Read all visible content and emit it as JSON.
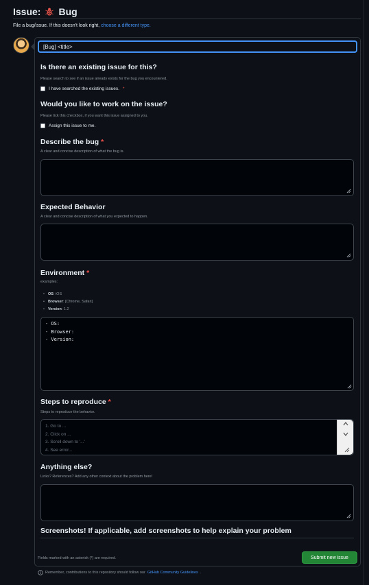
{
  "header": {
    "label": "Issue:",
    "template_name": "Bug",
    "icon": "bug-icon"
  },
  "subline": {
    "text": "File a bug/issue. If this doesn't look right,",
    "link": "choose a different type."
  },
  "title_input": {
    "value": "[Bug] <title>"
  },
  "sections": {
    "existing": {
      "heading": "Is there an existing issue for this?",
      "description": "Please search to see if an issue already exists for the bug you encountered.",
      "checkbox_label": "I have searched the existing issues.",
      "required_mark": "*"
    },
    "work": {
      "heading": "Would you like to work on the issue?",
      "description": "Please tick this checkbox, if you want this issue assigned to you.",
      "checkbox_label": "Assign this issue to me."
    },
    "describe": {
      "heading": "Describe the bug",
      "required_mark": "*",
      "description": "A clear and concise description of what the bug is."
    },
    "expected": {
      "heading": "Expected Behavior",
      "description": "A clear and concise description of what you expected to happen."
    },
    "environment": {
      "heading": "Environment",
      "required_mark": "*",
      "description": "examples:",
      "bullets": [
        {
          "key": "OS",
          "value": ": iOS"
        },
        {
          "key": "Browser",
          "value": ": [Chrome, Safari]"
        },
        {
          "key": "Version",
          "value": ": 1.2"
        }
      ],
      "textarea_value": "- OS:\n- Browser:\n- Version:"
    },
    "steps": {
      "heading": "Steps to reproduce",
      "required_mark": "*",
      "description": "Steps to reproduce the behavior.",
      "placeholder_lines": [
        "1. Go to ...",
        "2. Click on ...",
        "3. Scroll down to '...'",
        "4. See error..."
      ]
    },
    "anything": {
      "heading": "Anything else?",
      "description": "Links? References? Add any other context about the problem here!"
    },
    "screenshots": {
      "heading": "Screenshots! If applicable, add screenshots to help explain your problem"
    }
  },
  "footer": {
    "required_note": "Fields marked with an asterisk (*) are required.",
    "submit_label": "Submit new issue",
    "guidelines_text": "Remember, contributions to this repository should follow our",
    "guidelines_link": "GitHub Community Guidelines",
    "guidelines_end": "."
  },
  "colors": {
    "background": "#0d1117",
    "accent": "#4493f8",
    "required": "#f85149",
    "submit": "#238636"
  }
}
